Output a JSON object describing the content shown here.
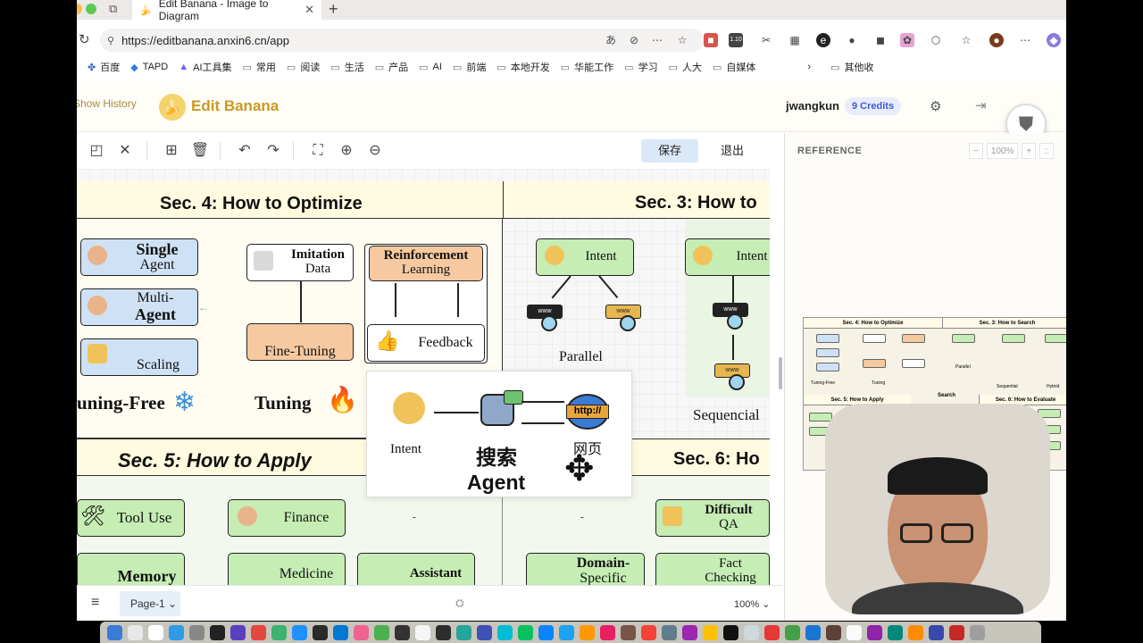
{
  "browser": {
    "tab_title": "Edit Banana - Image to Diagram",
    "url": "https://editbanana.anxin6.cn/app",
    "bookmarks": [
      "百度",
      "TAPD",
      "AI工具集",
      "常用",
      "阅读",
      "生活",
      "产品",
      "AI",
      "前端",
      "本地开发",
      "华能工作",
      "学习",
      "人大",
      "自媒体"
    ],
    "bookmarks_overflow": "其他收"
  },
  "app": {
    "show_history": "Show History",
    "brand": "Edit Banana",
    "user": "jwangkun",
    "credits": "9 Credits",
    "save": "保存",
    "exit": "退出",
    "reference_title": "REFERENCE",
    "ref_zoom": "100%",
    "page_tab": "Page-1",
    "zoom_level": "100%"
  },
  "diagram": {
    "sec4_title": "Sec. 4: How to Optimize",
    "sec3_title": "Sec. 3: How to",
    "sec5_title": "Sec. 5: How to Apply",
    "sec6_title": "Sec. 6: Ho",
    "single_agent_1": "Single",
    "single_agent_2": "Agent",
    "multi_agent_1": "Multi-",
    "multi_agent_2": "Agent",
    "scaling": "Scaling",
    "tuning_free": "uning-Free",
    "imitation_1": "Imitation",
    "imitation_2": "Data",
    "rl_1": "Reinforcement",
    "rl_2": "Learning",
    "fine_tuning": "Fine-Tuning",
    "feedback": "Feedback",
    "tuning": "Tuning",
    "intent_a": "Intent",
    "intent_b": "Intent",
    "parallel": "Parallel",
    "sequencial": "Sequencial",
    "popup_intent": "Intent",
    "popup_search": "搜索",
    "popup_agent": "Agent",
    "popup_web": "网页",
    "popup_url": "http://",
    "tool_use": "Tool Use",
    "finance": "Finance",
    "memory": "Memory",
    "medicine": "Medicine",
    "assistant": "Assistant",
    "difficult_qa_1": "Difficult",
    "difficult_qa_2": "QA",
    "domain_specific_1": "Domain-",
    "domain_specific_2": "Specific",
    "fact_checking_1": "Fact",
    "fact_checking_2": "Checking",
    "dash_a": "-",
    "dash_b": "-",
    "www_label": "www"
  },
  "reference_preview": {
    "sec4": "Sec. 4: How to Optimize",
    "sec3": "Sec. 3: How to Search",
    "sec5": "Sec. 5: How to Apply",
    "sec6": "Sec. 6: How to Evaluate",
    "parallel": "Parallel",
    "sequential": "Sequential",
    "hybrid": "Hybrid",
    "tuning_free": "Tuning-Free",
    "tuning": "Tuning",
    "search": "Search"
  },
  "colors": {
    "brand": "#c99a21",
    "blue_box": "#cfe1f5",
    "orange_box": "#f6c9a0",
    "green_box": "#c5edb4",
    "sec_bg": "#fffbe8"
  }
}
